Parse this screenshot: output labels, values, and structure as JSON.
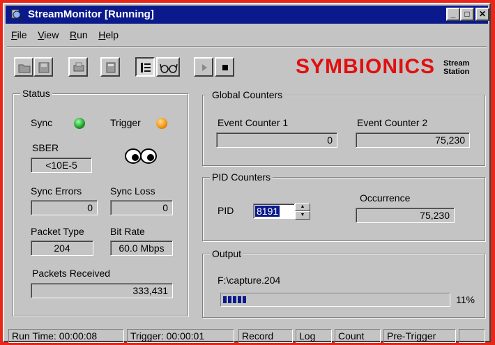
{
  "window": {
    "title": "StreamMonitor [Running]",
    "controls": {
      "minimize": "_",
      "maximize": "□",
      "close": "✕"
    }
  },
  "menu": [
    {
      "label": "File",
      "hotkey": "F",
      "rest": "ile"
    },
    {
      "label": "View",
      "hotkey": "V",
      "rest": "iew"
    },
    {
      "label": "Run",
      "hotkey": "R",
      "rest": "un"
    },
    {
      "label": "Help",
      "hotkey": "H",
      "rest": "elp"
    }
  ],
  "toolbar": {
    "icons": [
      "open-folder-icon",
      "save-icon",
      "print-icon",
      "calculator-icon",
      "list-view-icon",
      "glasses-icon",
      "play-icon",
      "stop-icon"
    ]
  },
  "logo": {
    "brand": "SYMBIONICS",
    "sub1": "Stream",
    "sub2": "Station",
    "brand_color": "#e01010"
  },
  "status": {
    "title": "Status",
    "sync_label": "Sync",
    "trigger_label": "Trigger",
    "sync_color": "#1a9a2a",
    "trigger_color": "#f09010",
    "sber_label": "SBER",
    "sber_value": "<10E-5",
    "sync_errors_label": "Sync Errors",
    "sync_errors_value": "0",
    "sync_loss_label": "Sync Loss",
    "sync_loss_value": "0",
    "packet_type_label": "Packet Type",
    "packet_type_value": "204",
    "bit_rate_label": "Bit Rate",
    "bit_rate_value": "60.0 Mbps",
    "packets_received_label": "Packets Received",
    "packets_received_value": "333,431"
  },
  "global_counters": {
    "title": "Global Counters",
    "event1_label": "Event Counter 1",
    "event1_value": "0",
    "event2_label": "Event Counter 2",
    "event2_value": "75,230"
  },
  "pid_counters": {
    "title": "PID Counters",
    "pid_label": "PID",
    "pid_value": "8191",
    "occurrence_label": "Occurrence",
    "occurrence_value": "75,230"
  },
  "output": {
    "title": "Output",
    "file_path": "F:\\capture.204",
    "progress_percent": 11,
    "progress_text": "11%"
  },
  "statusbar": {
    "run_time": "Run Time: 00:00:08",
    "trigger": "Trigger: 00:00:01",
    "record": "Record",
    "log": "Log",
    "count": "Count",
    "pre_trigger": "Pre-Trigger"
  }
}
